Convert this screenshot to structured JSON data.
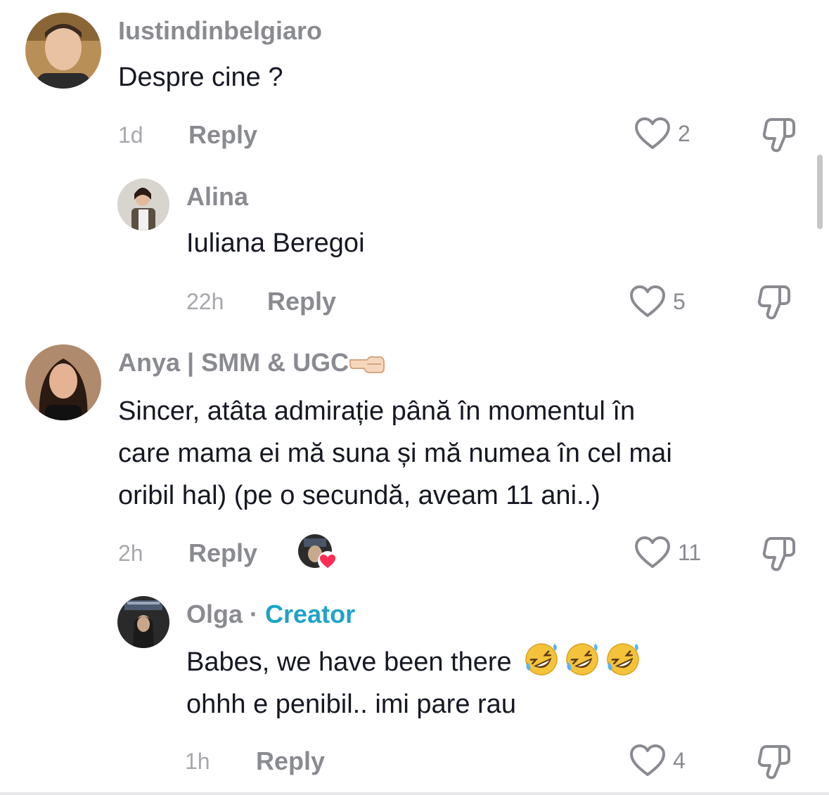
{
  "comments": [
    {
      "username": "Iustindinbelgiaro",
      "text": "Despre cine ?",
      "time": "1d",
      "reply_label": "Reply",
      "likes": "2"
    },
    {
      "username": "Alina",
      "text": "Iuliana Beregoi",
      "time": "22h",
      "reply_label": "Reply",
      "likes": "5"
    },
    {
      "username": "Anya | SMM & UGC",
      "username_emoji_icon": "backhand-index-pointing-left-icon",
      "text_lines": [
        "Sincer, atâta admirație până în momentul în",
        "care mama ei mă suna și mă numea în cel mai",
        "oribil hal) (pe o secundă, aveam 11 ani..)"
      ],
      "time": "2h",
      "reply_label": "Reply",
      "likes": "11",
      "liked_by_creator": true
    },
    {
      "username": "Olga",
      "separator": "·",
      "badge": "Creator",
      "text_lines": [
        "Babes, we have been there",
        "ohhh e penibil.. imi pare rau"
      ],
      "text_emoji_icons": [
        "rolling-on-floor-laughing-icon",
        "rolling-on-floor-laughing-icon",
        "rolling-on-floor-laughing-icon"
      ],
      "time": "1h",
      "reply_label": "Reply",
      "likes": "4"
    }
  ],
  "colors": {
    "username": "#8a8b91",
    "text": "#161823",
    "creator_badge": "#1fa3c8",
    "liked_heart": "#fe2c55"
  }
}
